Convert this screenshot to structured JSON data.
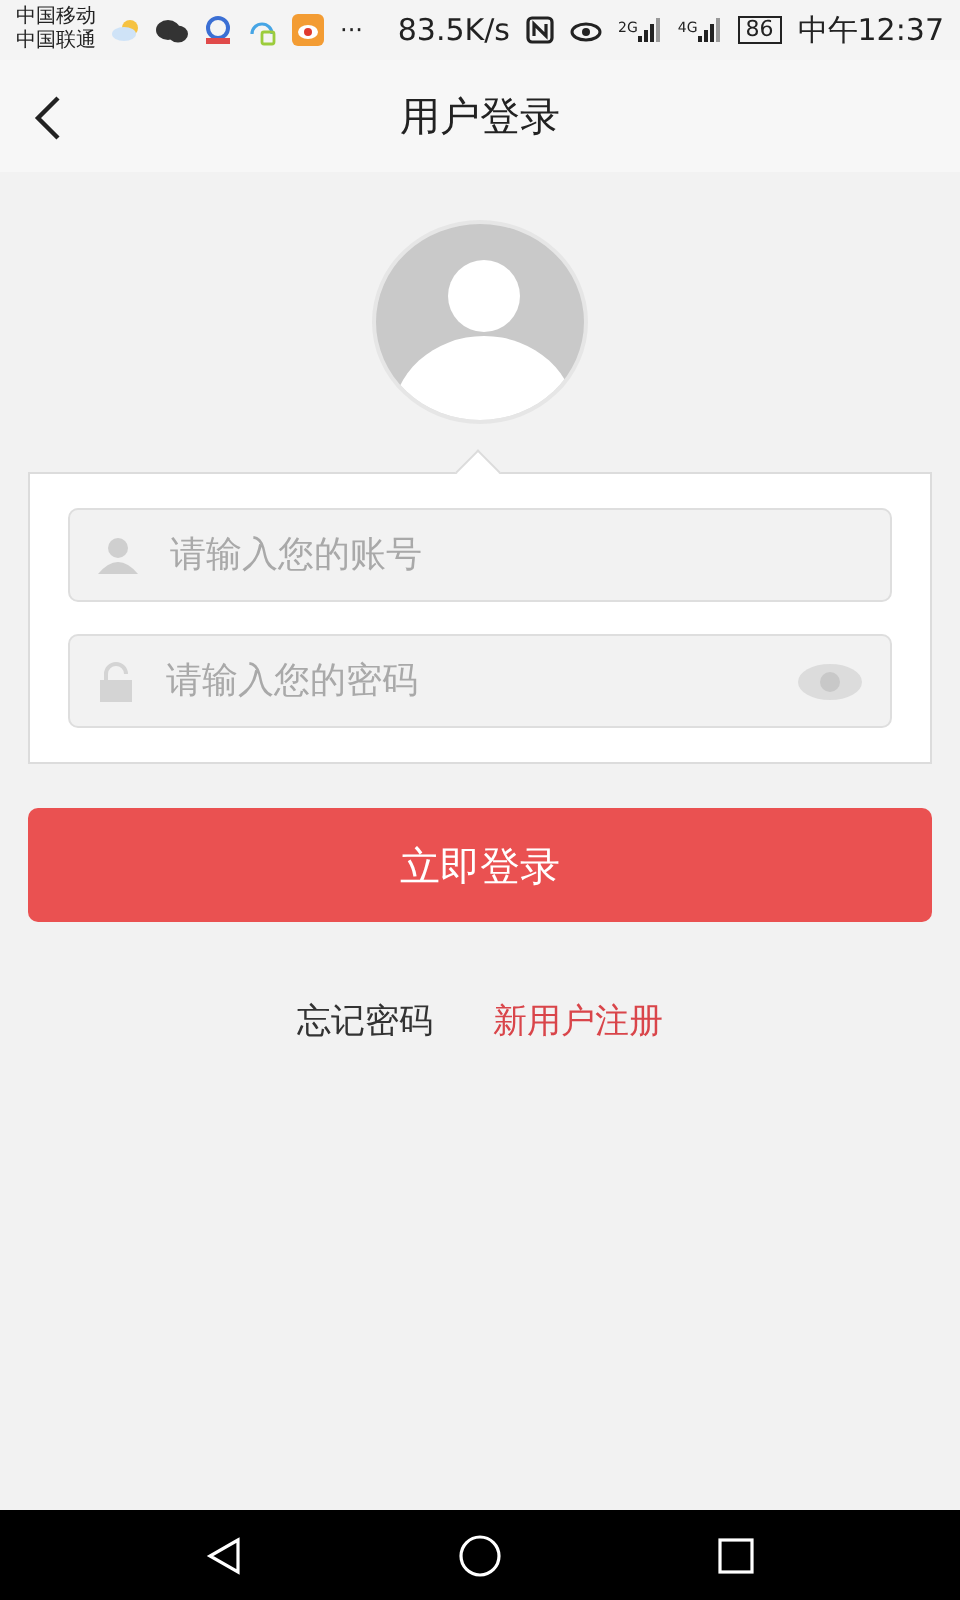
{
  "status_bar": {
    "carriers": [
      "中国移动",
      "中国联通"
    ],
    "more": "···",
    "speed": "83.5K/s",
    "network_1": "2G",
    "network_2": "4G",
    "battery": "86",
    "time": "中午12:37"
  },
  "header": {
    "title": "用户登录"
  },
  "form": {
    "account": {
      "placeholder": "请输入您的账号"
    },
    "password": {
      "placeholder": "请输入您的密码"
    }
  },
  "login_button": "立即登录",
  "links": [
    {
      "label": "忘记密码",
      "kind": "plain"
    },
    {
      "label": "新用户注册",
      "kind": "accent"
    }
  ]
}
